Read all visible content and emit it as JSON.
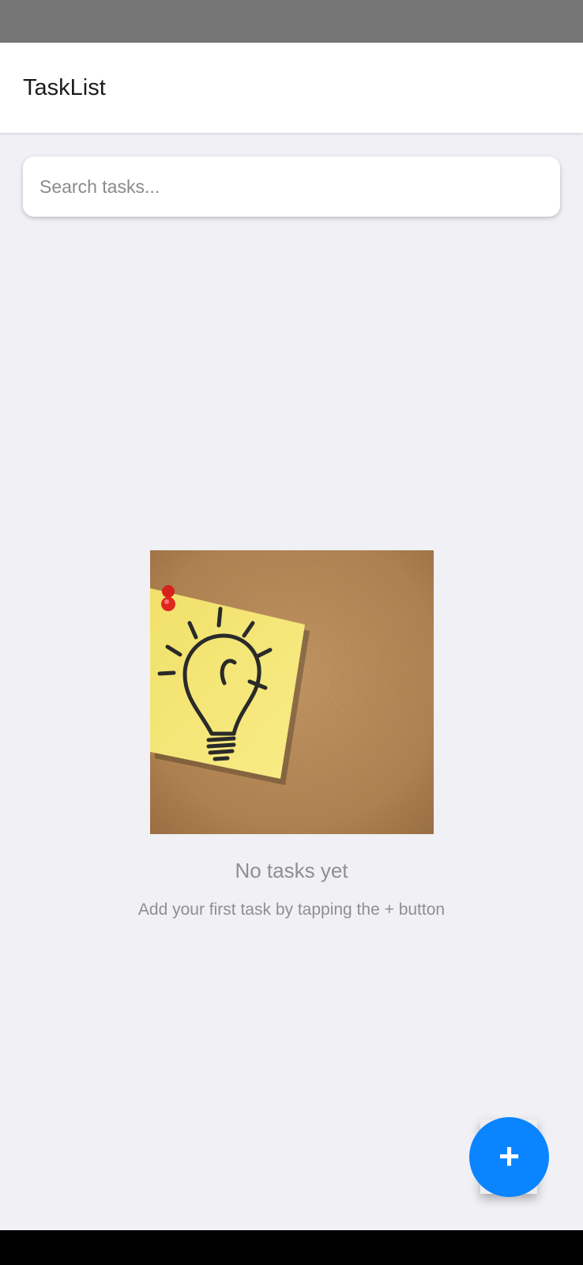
{
  "app": {
    "title": "TaskList"
  },
  "search": {
    "placeholder": "Search tasks...",
    "value": ""
  },
  "empty_state": {
    "image_icon": "lightbulb-sticky-note",
    "title": "No tasks yet",
    "subtitle": "Add your first task by tapping the + button"
  },
  "fab": {
    "label": "+",
    "icon": "plus-icon"
  },
  "colors": {
    "accent": "#0a84ff",
    "background": "#f0f0f5",
    "status_bar": "#757575",
    "sticky_note": "#f6e87a",
    "cork": "#b98c5a"
  }
}
